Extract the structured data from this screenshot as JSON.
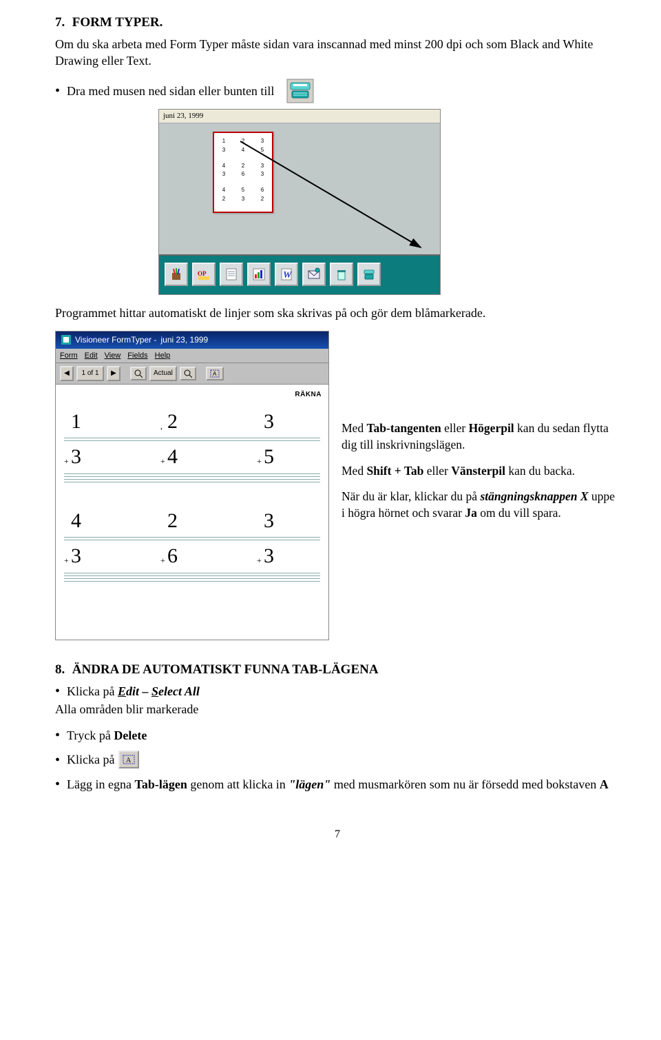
{
  "section7": {
    "num": "7.",
    "title": "FORM TYPER.",
    "intro": "Om du ska arbeta med Form Typer måste sidan vara inscannad med minst 200 dpi och som Black and White Drawing eller Text.",
    "bullet1": "Dra med musen ned sidan eller bunten till",
    "after_shot1": "Programmet hittar automatiskt de linjer som ska skrivas på och gör dem blåmarkerade.",
    "tips": {
      "p1_a": "Med ",
      "p1_b": "Tab-tangenten",
      "p1_c": " eller ",
      "p1_d": "Högerpil",
      "p1_e": " kan du sedan flytta dig till inskrivningslägen.",
      "p2_a": "Med ",
      "p2_b": "Shift + Tab",
      "p2_c": " eller ",
      "p2_d": "Vänsterpil",
      "p2_e": " kan du backa.",
      "p3_a": "När du är klar, klickar du på ",
      "p3_b": "stängningsknappen X",
      "p3_c": " uppe i högra hörnet och svarar ",
      "p3_d": "Ja",
      "p3_e": " om du vill spara."
    }
  },
  "shot1": {
    "date_label": "juni 23, 1999",
    "thumb_rows": [
      [
        "1",
        "2",
        "3"
      ],
      [
        "3",
        "4",
        "5"
      ],
      [
        "4",
        "2",
        "3"
      ],
      [
        "3",
        "6",
        "3"
      ],
      [
        "4",
        "5",
        "6"
      ],
      [
        "2",
        "3",
        "2"
      ]
    ],
    "toolbar_icons": [
      "pencil-cup-icon",
      "op-logo-icon",
      "notepad-icon",
      "chart-icon",
      "word-icon",
      "mail-icon",
      "trash-icon",
      "typewriter-icon"
    ]
  },
  "shot2": {
    "title_prefix": "Visioneer FormTyper - ",
    "title_doc": "juni 23, 1999",
    "menus": [
      "Form",
      "Edit",
      "View",
      "Fields",
      "Help"
    ],
    "tool_prev": "◀",
    "tool_page": "1 of 1",
    "tool_next": "▶",
    "tool_zoom_out": "🔍",
    "tool_zoom_label": "Actual",
    "tool_zoom_in": "🔍",
    "tool_addfield": "A",
    "rakna": "RÄKNA",
    "grid": {
      "block1": [
        [
          "1",
          "2",
          "3"
        ],
        [
          "3",
          "4",
          "5"
        ]
      ],
      "block2": [
        [
          "4",
          "2",
          "3"
        ],
        [
          "3",
          "6",
          "3"
        ]
      ]
    }
  },
  "section8": {
    "num": "8.",
    "title": "ÄNDRA DE AUTOMATISKT FUNNA TAB-LÄGENA",
    "b1_a": "Klicka på ",
    "b1_b": "Edit – Select All",
    "b1_after": "Alla områden blir markerade",
    "b2_a": "Tryck på ",
    "b2_b": "Delete",
    "b3": "Klicka på",
    "b4_a": "Lägg in egna ",
    "b4_b": "Tab-lägen",
    "b4_c": " genom att klicka in ",
    "b4_d": "\"lägen\"",
    "b4_e": " med musmarkören som nu är försedd med bokstaven ",
    "b4_f": "A"
  },
  "page_number": "7"
}
